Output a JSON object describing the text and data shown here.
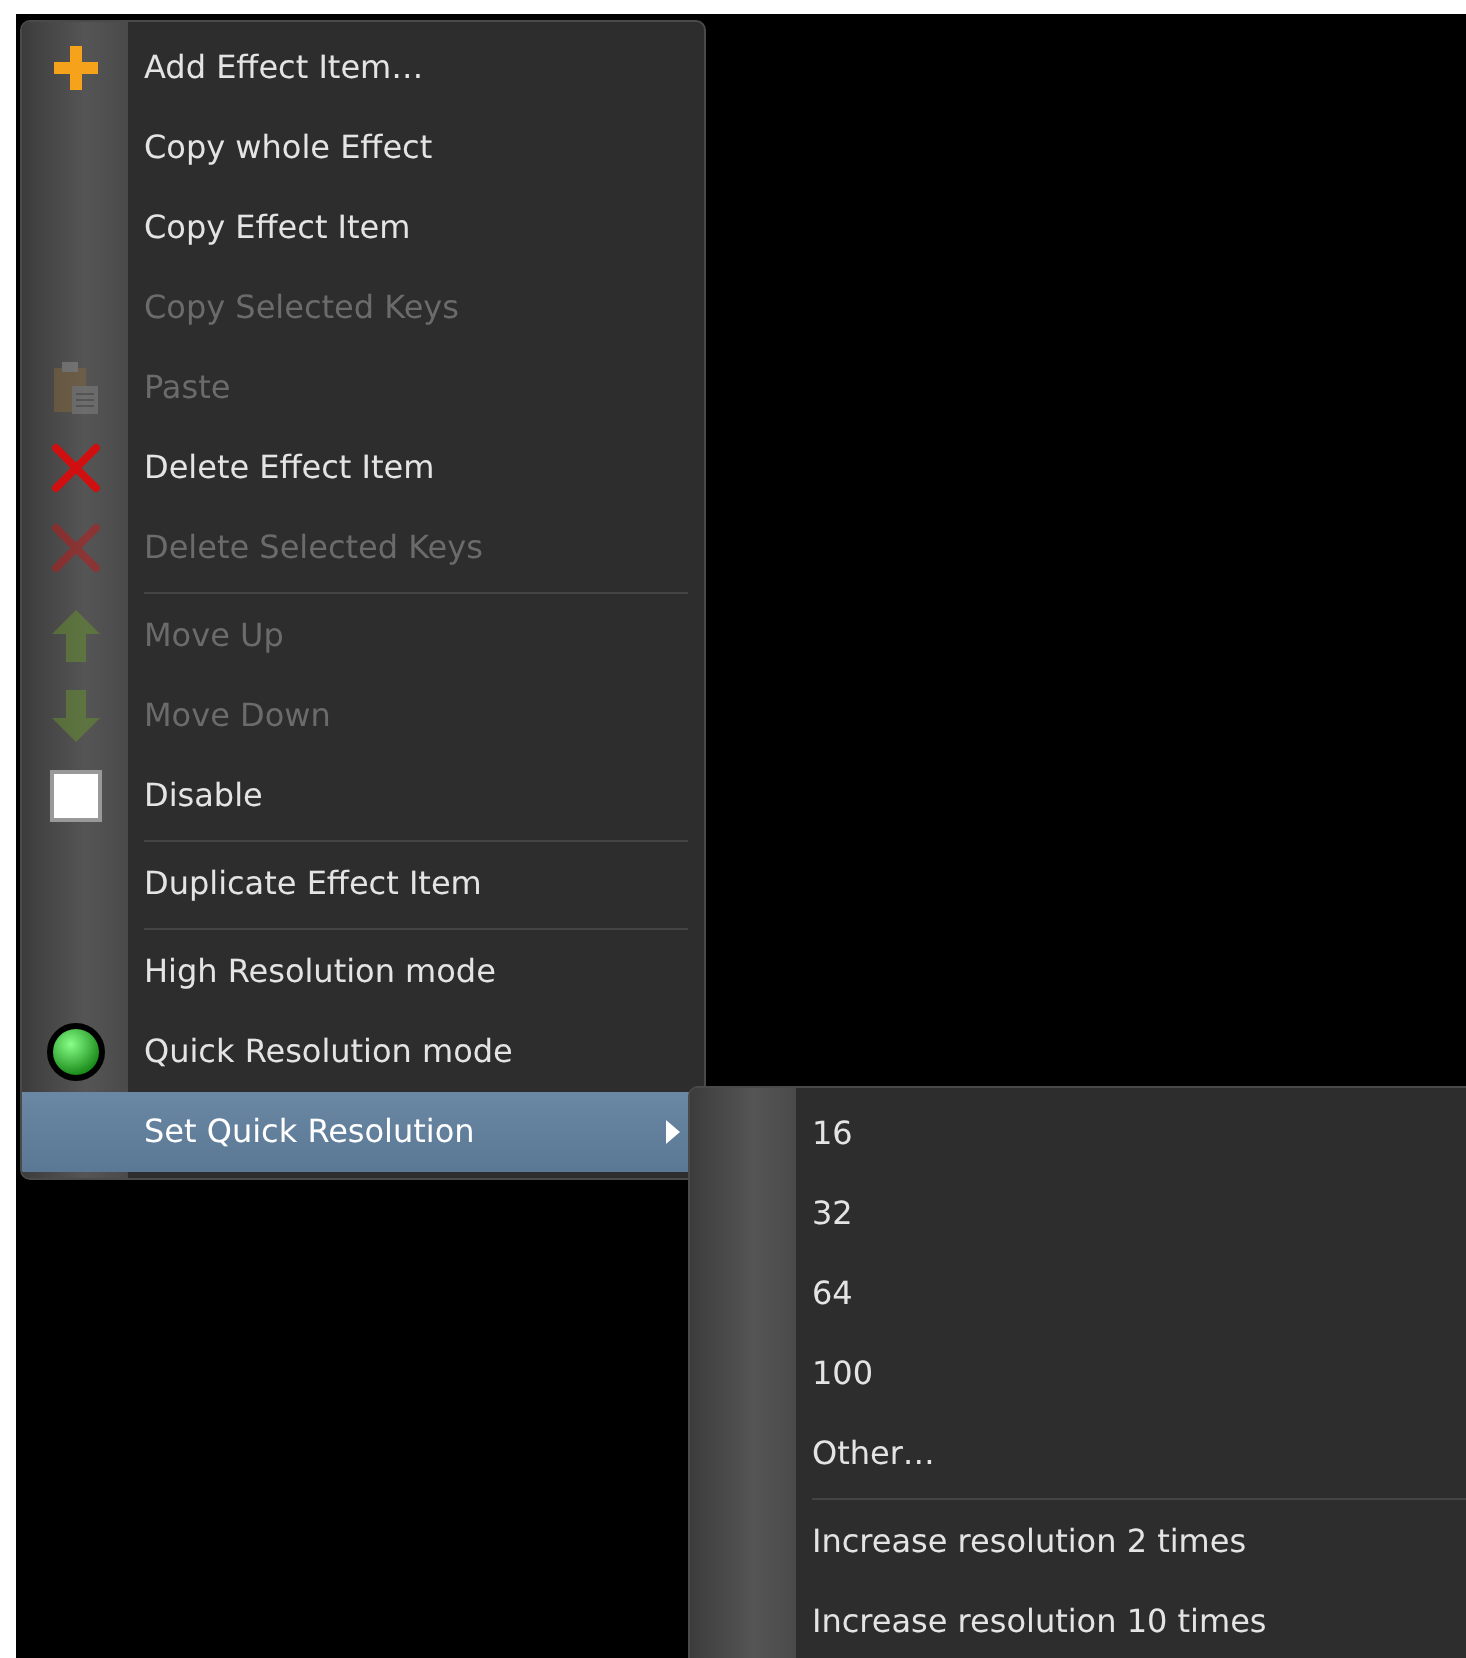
{
  "context_menu": {
    "items": [
      {
        "kind": "command",
        "label": "Add Effect Item…",
        "disabled": false,
        "selected": false
      },
      {
        "kind": "command",
        "label": "Copy whole Effect",
        "disabled": false,
        "selected": false
      },
      {
        "kind": "command",
        "label": "Copy Effect Item",
        "disabled": false,
        "selected": false
      },
      {
        "kind": "command",
        "label": "Copy Selected Keys",
        "disabled": true,
        "selected": false
      },
      {
        "kind": "command",
        "label": "Paste",
        "disabled": true,
        "selected": false
      },
      {
        "kind": "command",
        "label": "Delete Effect Item",
        "disabled": false,
        "selected": false
      },
      {
        "kind": "command",
        "label": "Delete Selected Keys",
        "disabled": true,
        "selected": false
      },
      {
        "kind": "separator"
      },
      {
        "kind": "command",
        "label": "Move Up",
        "disabled": true,
        "selected": false
      },
      {
        "kind": "command",
        "label": "Move Down",
        "disabled": true,
        "selected": false
      },
      {
        "kind": "checkbox",
        "label": "Disable",
        "checked": false,
        "disabled": false,
        "selected": false
      },
      {
        "kind": "separator"
      },
      {
        "kind": "command",
        "label": "Duplicate Effect Item",
        "disabled": false,
        "selected": false
      },
      {
        "kind": "separator"
      },
      {
        "kind": "radio",
        "label": "High Resolution mode",
        "on": false,
        "disabled": false,
        "selected": false
      },
      {
        "kind": "radio",
        "label": "Quick Resolution mode",
        "on": true,
        "disabled": false,
        "selected": false
      },
      {
        "kind": "submenu",
        "label": "Set Quick Resolution",
        "disabled": false,
        "selected": true
      }
    ]
  },
  "submenu": {
    "items": [
      {
        "kind": "command",
        "label": "16",
        "disabled": false,
        "selected": false
      },
      {
        "kind": "command",
        "label": "32",
        "disabled": false,
        "selected": false
      },
      {
        "kind": "command",
        "label": "64",
        "disabled": false,
        "selected": false
      },
      {
        "kind": "command",
        "label": "100",
        "disabled": false,
        "selected": false
      },
      {
        "kind": "command",
        "label": "Other…",
        "disabled": false,
        "selected": false
      },
      {
        "kind": "separator"
      },
      {
        "kind": "command",
        "label": "Increase resolution 2 times",
        "disabled": false,
        "selected": false
      },
      {
        "kind": "command",
        "label": "Increase resolution 10 times",
        "disabled": false,
        "selected": false
      }
    ]
  }
}
